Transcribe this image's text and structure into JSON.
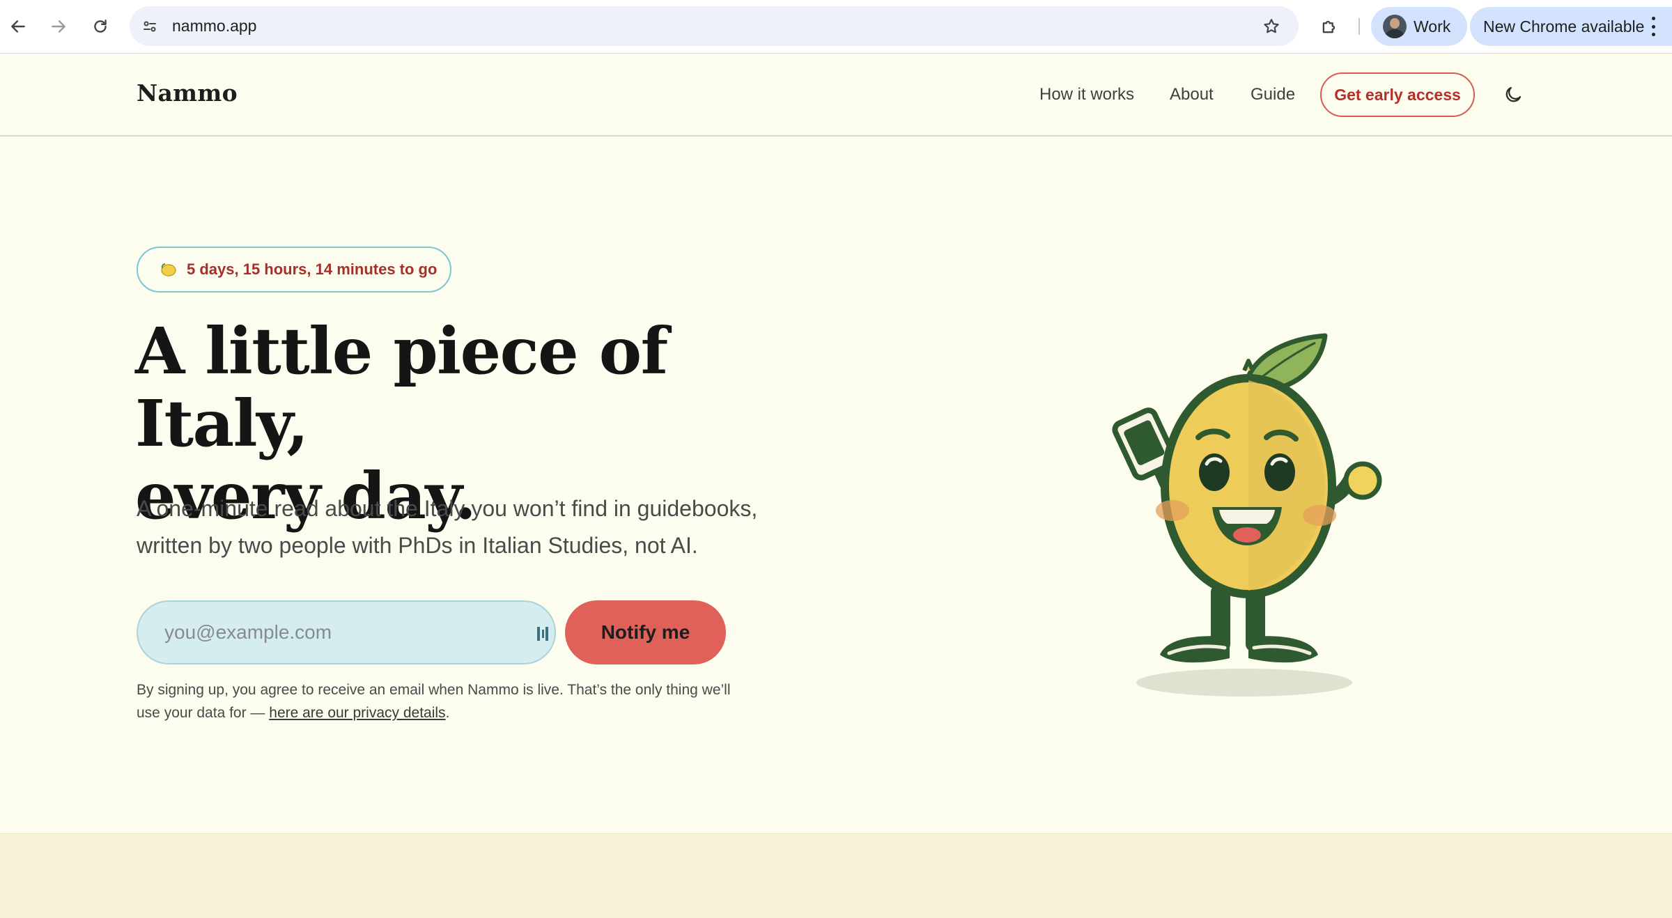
{
  "browser": {
    "url": "nammo.app",
    "profile_label": "Work",
    "update_label": "New Chrome available"
  },
  "site": {
    "logo": "Nammo",
    "nav": [
      {
        "label": "How it works"
      },
      {
        "label": "About"
      },
      {
        "label": "Guide"
      }
    ],
    "cta_label": "Get early access"
  },
  "hero": {
    "countdown": "5 days, 15 hours, 14 minutes to go",
    "headline_line1": "A little piece of Italy,",
    "headline_line2": "every day.",
    "subhead_line1": "A one-minute read about the Italy you won’t find in guidebooks,",
    "subhead_line2": "written by two people with PhDs in Italian Studies, not AI.",
    "email_placeholder": "you@example.com",
    "notify_label": "Notify me",
    "disclaimer_line1": "By signing up, you agree to receive an email when Nammo is live. That’s the only thing we’ll",
    "disclaimer_line2_prefix": "use your data for — ",
    "privacy_link": "here are our privacy details",
    "disclaimer_suffix": "."
  },
  "colors": {
    "page_bg": "#fcfcef",
    "accent": "#e0605a",
    "accent_text": "#b3312a",
    "input_bg": "#d6edf0",
    "footer_band": "#f7f3d8"
  },
  "icons": [
    "back-icon",
    "forward-icon",
    "reload-icon",
    "site-info-icon",
    "bookmark-star-icon",
    "extensions-icon",
    "more-menu-icon",
    "moon-icon",
    "lemon-icon",
    "password-manager-icon"
  ]
}
